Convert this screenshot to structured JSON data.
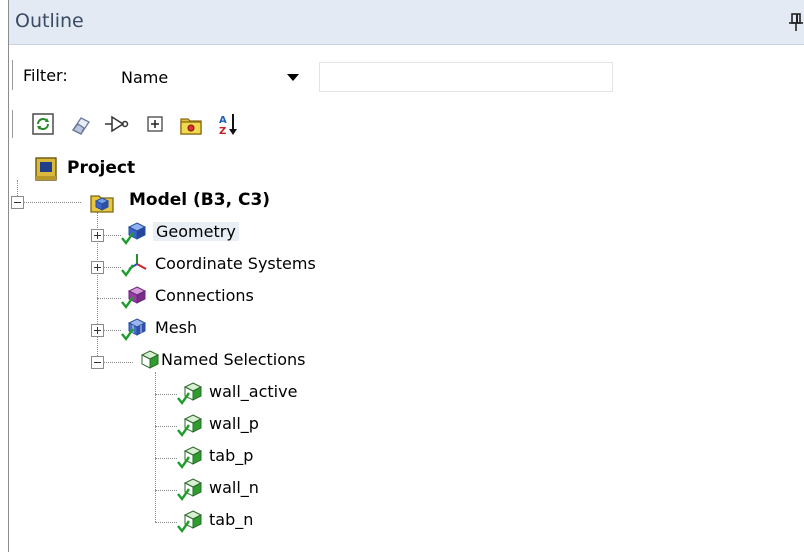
{
  "title": "Outline",
  "filter": {
    "label": "Filter:",
    "selected": "Name",
    "text_value": ""
  },
  "toolbar": {
    "buttons": [
      "refresh-icon",
      "eraser-icon",
      "merge-icon",
      "expand-all-icon",
      "folder-icon",
      "sort-az-icon"
    ]
  },
  "tree": {
    "project": "Project",
    "model": "Model (B3, C3)",
    "geometry": "Geometry",
    "coordinate_systems": "Coordinate Systems",
    "connections": "Connections",
    "mesh": "Mesh",
    "named_selections": "Named Selections",
    "named_items": [
      "wall_active",
      "wall_p",
      "tab_p",
      "wall_n",
      "tab_n"
    ]
  },
  "colors": {
    "titlebar": "#e3eaf3",
    "check": "#1f9e2c",
    "cube_blue": "#3b63c9",
    "cube_green": "#2e9d2e"
  }
}
